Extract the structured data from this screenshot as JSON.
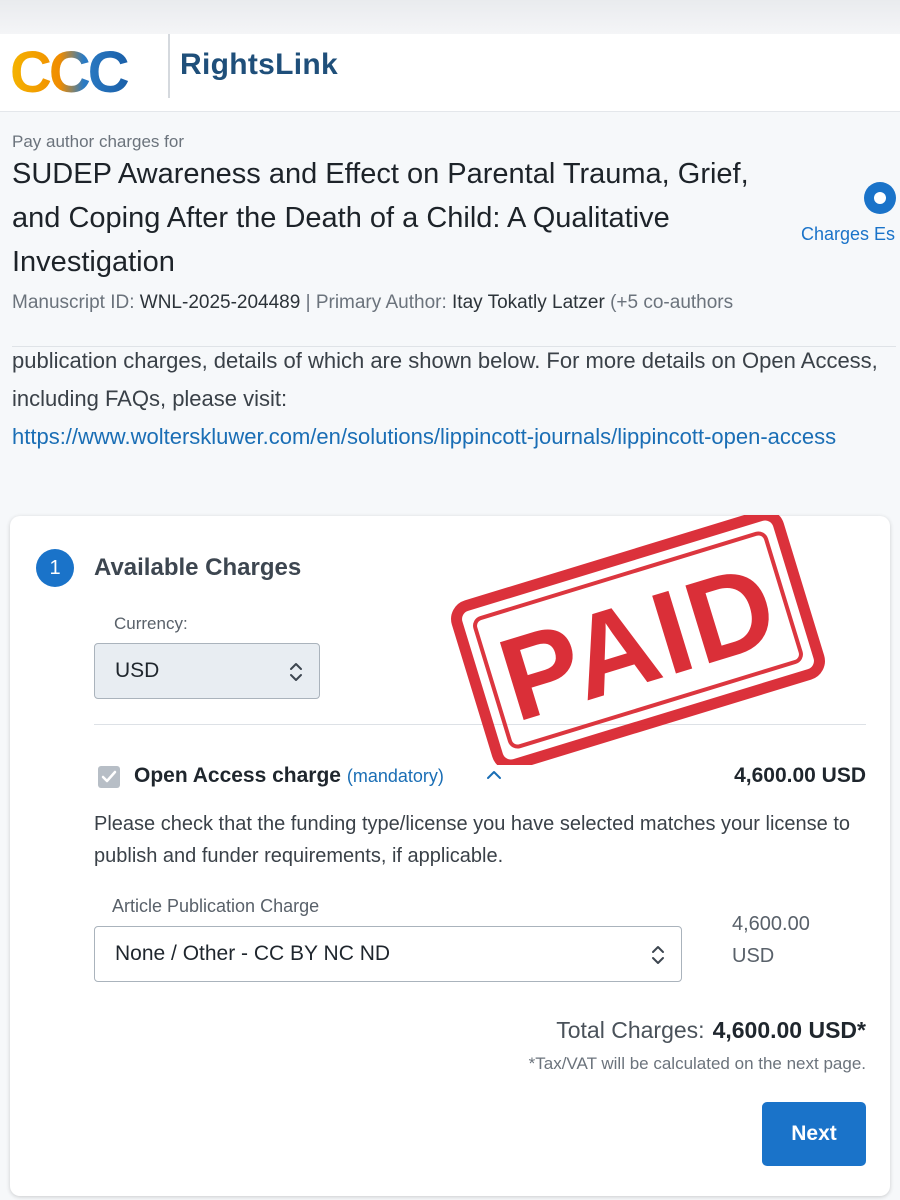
{
  "brand": {
    "logo_text": "CCC",
    "product": "RightsLink",
    "colors": {
      "ccc_left": "#f2a900",
      "ccc_right": "#1f6fb5",
      "accent": "#1a73c9",
      "stamp": "#d8202a"
    }
  },
  "order": {
    "kicker": "Pay author charges for",
    "title": "SUDEP Awareness and Effect on Parental Trauma, Grief, and Coping After the Death of a Child: A Qualitative Investigation",
    "manuscript_label": "Manuscript ID:",
    "manuscript_id": "WNL-2025-204489",
    "separator": "|",
    "author_label": "Primary Author:",
    "author": "Itay Tokatly Latzer",
    "coauthors": "(+5 co-authors"
  },
  "progress": {
    "step_label": "Charges Es",
    "icon": "radio-selected-icon"
  },
  "intro": {
    "text": "publication charges, details of which are shown below. For more details on Open Access, including FAQs, please visit:",
    "link": "https://www.wolterskluwer.com/en/solutions/lippincott-journals/lippincott-open-access"
  },
  "charges": {
    "step_number": "1",
    "title": "Available Charges",
    "currency_label": "Currency:",
    "currency_value": "USD",
    "oa_label": "Open Access charge",
    "oa_mandatory": "(mandatory)",
    "oa_amount": "4,600.00 USD",
    "note": "Please check that the funding type/license you have selected matches your license to publish and funder requirements, if applicable.",
    "apc_label": "Article Publication Charge",
    "apc_value": "None / Other - CC BY NC ND",
    "apc_amount": "4,600.00 USD",
    "total_label": "Total Charges:",
    "total_value": "4,600.00 USD*",
    "tax_note": "*Tax/VAT will be calculated on the next page.",
    "next_label": "Next"
  },
  "stamp": {
    "text": "PAID"
  }
}
